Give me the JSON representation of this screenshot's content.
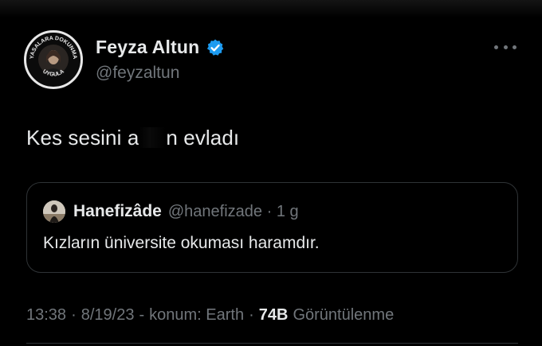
{
  "author": {
    "name": "Feyza Altun",
    "handle": "@feyzaltun",
    "avatar_text_top": "YASALARA DOKUNMA",
    "avatar_text_bottom": "UYGULA"
  },
  "tweet": {
    "text_before": "Kes sesini a",
    "text_after": "n evladı"
  },
  "quoted": {
    "name": "Hanefizâde",
    "handle_time": "@hanefizade · 1 g",
    "text": "Kızların üniversite okuması haramdır."
  },
  "meta": {
    "time": "13:38",
    "date": "8/19/23",
    "location": "konum: Earth",
    "views_count": "74B",
    "views_label": "Görüntülenme"
  },
  "colors": {
    "background": "#000000",
    "text": "#e7e9ea",
    "muted": "#71767b",
    "verified": "#1d9bf0",
    "border": "#2f3336"
  }
}
